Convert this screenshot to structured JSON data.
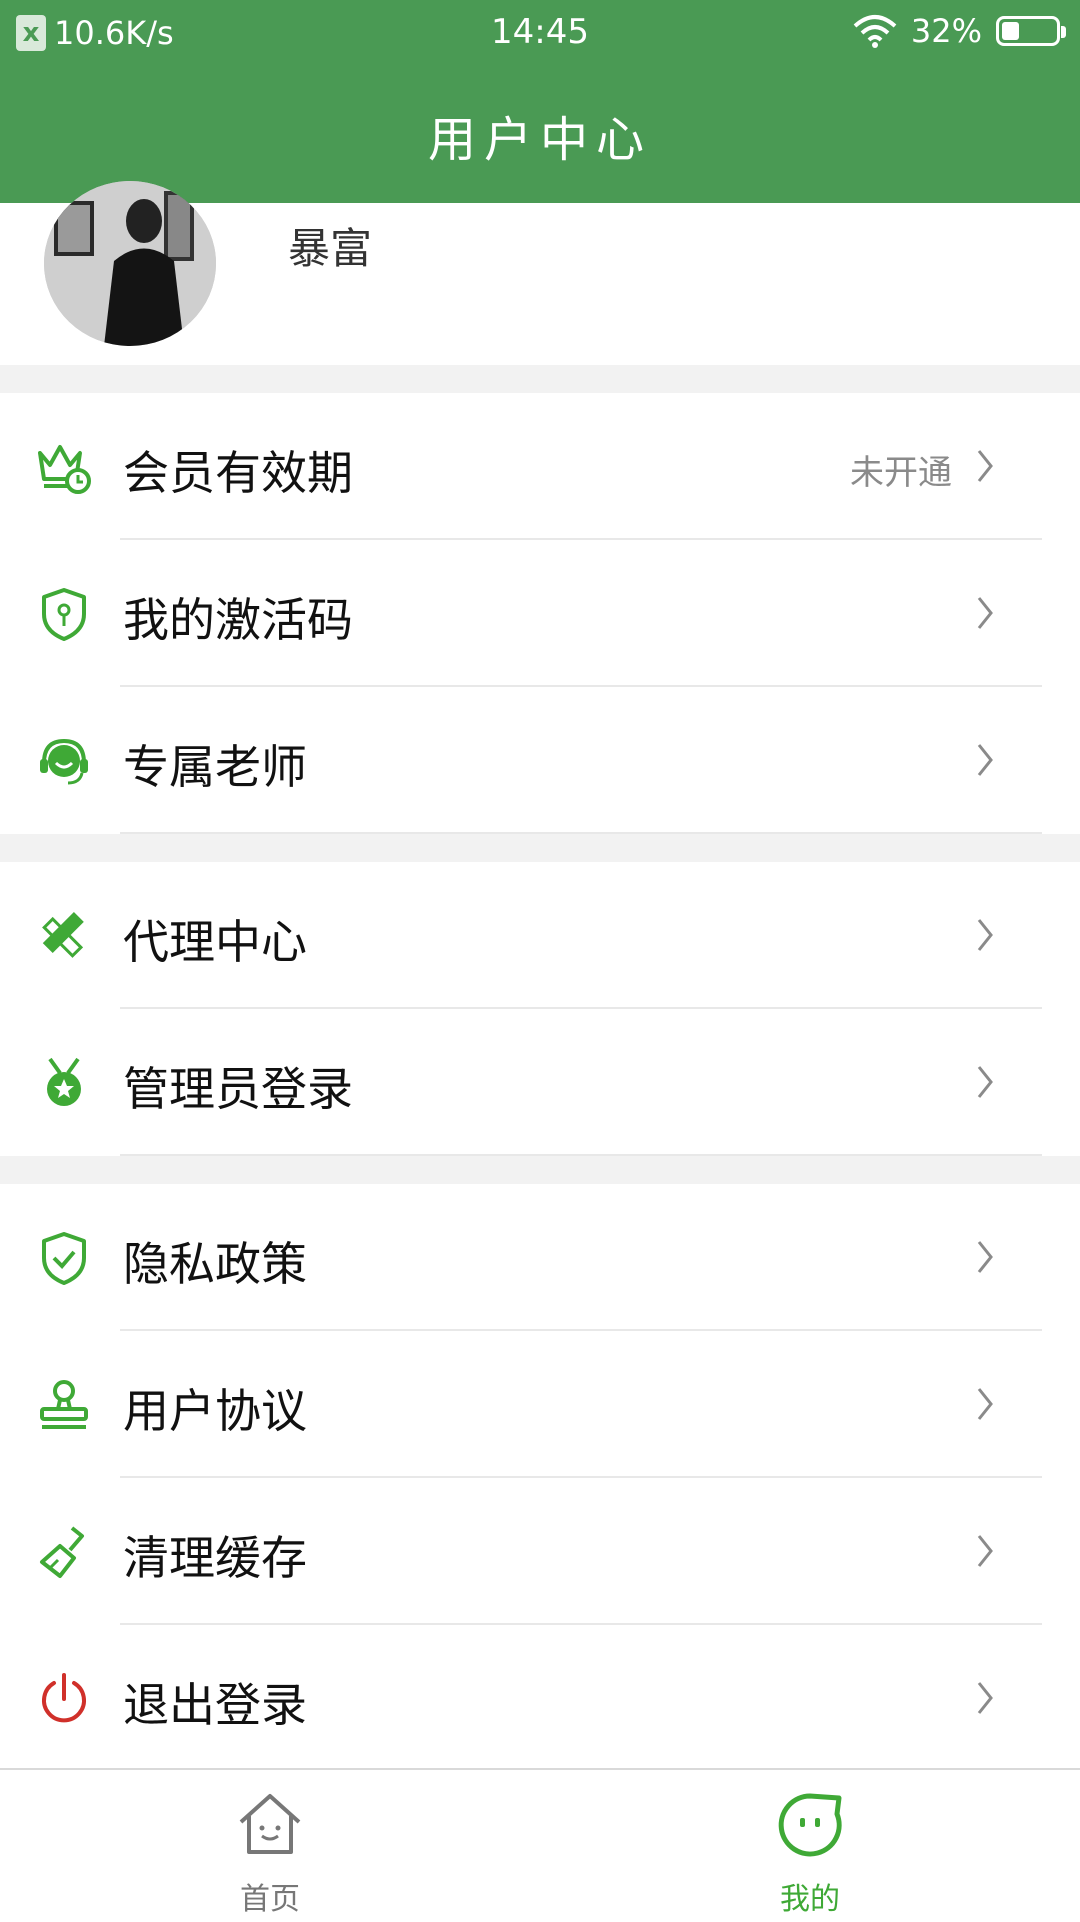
{
  "status_bar": {
    "net_speed": "10.6K/s",
    "time": "14:45",
    "battery_percent": "32%",
    "battery_level": 0.32
  },
  "header": {
    "title": "用户中心"
  },
  "profile": {
    "username": "暴富"
  },
  "menu_sections": [
    {
      "items": [
        {
          "label": "会员有效期",
          "value": "未开通",
          "icon": "crown-clock-icon"
        },
        {
          "label": "我的激活码",
          "icon": "shield-key-icon"
        },
        {
          "label": "专属老师",
          "icon": "headset-icon"
        }
      ]
    },
    {
      "items": [
        {
          "label": "代理中心",
          "icon": "pencil-ruler-icon"
        },
        {
          "label": "管理员登录",
          "icon": "medal-icon"
        }
      ]
    },
    {
      "items": [
        {
          "label": "隐私政策",
          "icon": "shield-check-icon"
        },
        {
          "label": "用户协议",
          "icon": "stamp-icon"
        },
        {
          "label": "清理缓存",
          "icon": "brush-icon"
        },
        {
          "label": "退出登录",
          "icon": "power-icon"
        }
      ]
    }
  ],
  "tab_bar": {
    "tabs": [
      {
        "label": "首页",
        "icon": "home-icon",
        "active": false
      },
      {
        "label": "我的",
        "icon": "smiley-bubble-icon",
        "active": true
      }
    ]
  },
  "colors": {
    "brand": "#4a9a54",
    "accent_green": "#3fa936",
    "danger": "#d0302a",
    "gray_text": "#8a8a8a"
  }
}
